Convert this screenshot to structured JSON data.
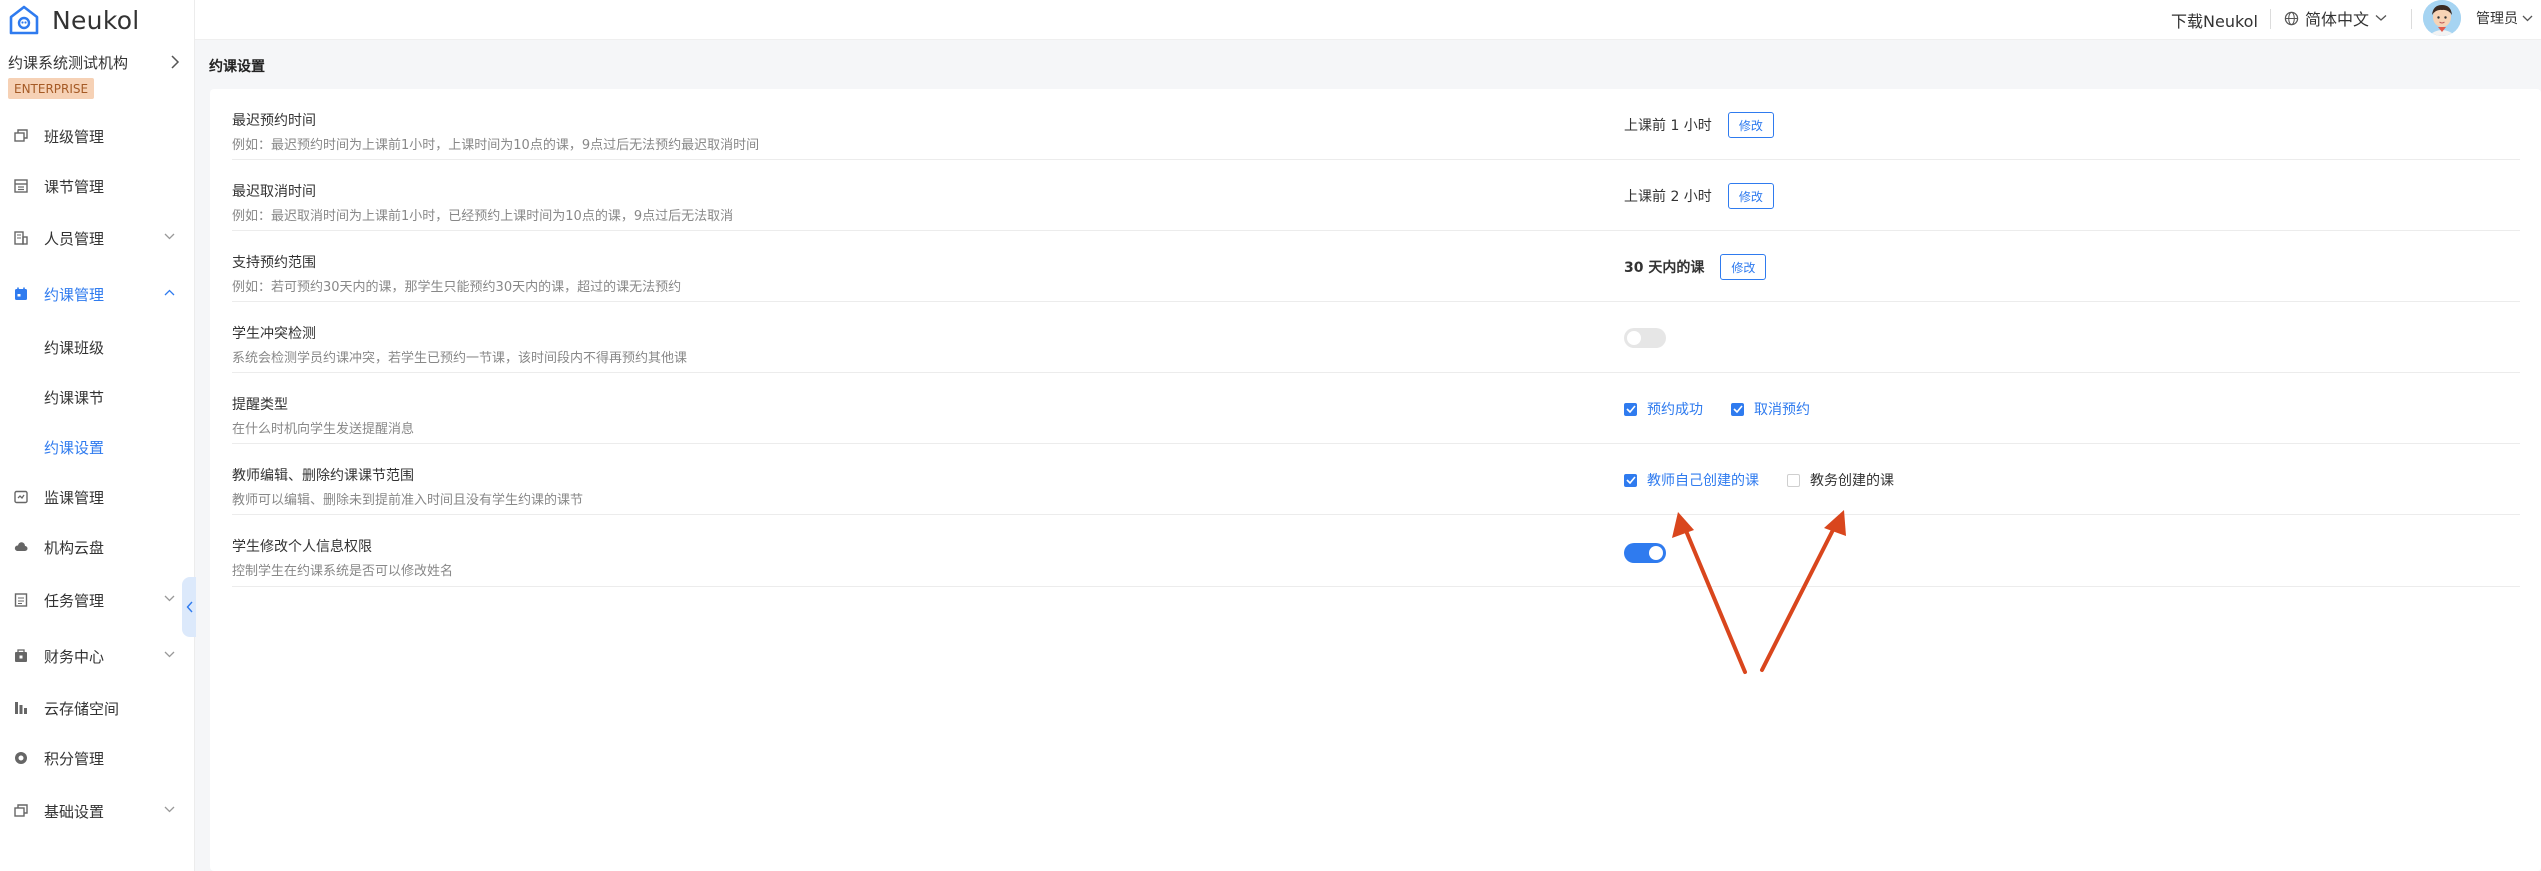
{
  "app": {
    "logo_text": "Neukol"
  },
  "sidebar": {
    "org_name": "约课系统测试机构",
    "edition_badge": "ENTERPRISE",
    "items": [
      {
        "label": "班级管理",
        "icon": "class-icon",
        "arrow": false
      },
      {
        "label": "课节管理",
        "icon": "lesson-icon",
        "arrow": false
      },
      {
        "label": "人员管理",
        "icon": "people-icon",
        "arrow": "down"
      },
      {
        "label": "约课管理",
        "icon": "booking-icon",
        "arrow": "up",
        "active": true
      },
      {
        "label": "监课管理",
        "icon": "monitor-icon",
        "arrow": false
      },
      {
        "label": "机构云盘",
        "icon": "cloud-icon",
        "arrow": false
      },
      {
        "label": "任务管理",
        "icon": "task-icon",
        "arrow": "down"
      },
      {
        "label": "财务中心",
        "icon": "finance-icon",
        "arrow": "down"
      },
      {
        "label": "云存储空间",
        "icon": "storage-icon",
        "arrow": false
      },
      {
        "label": "积分管理",
        "icon": "points-icon",
        "arrow": false
      },
      {
        "label": "基础设置",
        "icon": "settings-icon",
        "arrow": "down"
      }
    ],
    "subitems": [
      {
        "label": "约课班级"
      },
      {
        "label": "约课课节"
      },
      {
        "label": "约课设置",
        "active": true
      }
    ]
  },
  "topbar": {
    "download_label": "下载Neukol",
    "language": "简体中文",
    "user": "管理员"
  },
  "page": {
    "title": "约课设置"
  },
  "settings": [
    {
      "title": "最迟预约时间",
      "desc": "例如：最迟预约时间为上课前1小时，上课时间为10点的课，9点过后无法预约最迟取消时间",
      "value": "上课前 1 小时",
      "button": "修改"
    },
    {
      "title": "最迟取消时间",
      "desc": "例如：最迟取消时间为上课前1小时，已经预约上课时间为10点的课，9点过后无法取消",
      "value": "上课前 2 小时",
      "button": "修改"
    },
    {
      "title": "支持预约范围",
      "desc": "例如：若可预约30天内的课，那学生只能预约30天内的课，超过的课无法预约",
      "value": "30 天内的课",
      "button": "修改"
    },
    {
      "title": "学生冲突检测",
      "desc": "系统会检测学员约课冲突，若学生已预约一节课，该时间段内不得再预约其他课",
      "toggle": false
    },
    {
      "title": "提醒类型",
      "desc": "在什么时机向学生发送提醒消息",
      "options": [
        {
          "label": "预约成功",
          "checked": true
        },
        {
          "label": "取消预约",
          "checked": true
        }
      ]
    },
    {
      "title": "教师编辑、删除约课课节范围",
      "desc": "教师可以编辑、删除未到提前准入时间且没有学生约课的课节",
      "options": [
        {
          "label": "教师自己创建的课",
          "checked": true
        },
        {
          "label": "教务创建的课",
          "checked": false
        }
      ]
    },
    {
      "title": "学生修改个人信息权限",
      "desc": "控制学生在约课系统是否可以修改姓名",
      "toggle": true
    }
  ],
  "colors": {
    "accent": "#2f7bef",
    "arrow": "#d9461d",
    "badge_bg": "#f6d1b5"
  }
}
